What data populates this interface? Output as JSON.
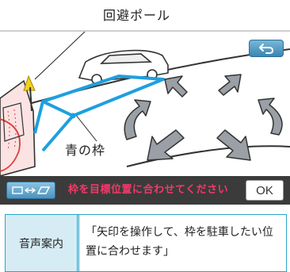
{
  "callouts": {
    "pole_label": "回避ポール",
    "frame_label": "青の枠"
  },
  "screen": {
    "back_icon": "return-arrow-icon",
    "switch_icon": "mode-switch-icon",
    "instruction": "枠を目標位置に合わせてください",
    "ok_label": "OK",
    "colors": {
      "frame": "#1e9fe0",
      "instruction": "#f03a6a",
      "button_blue": "#4c92be",
      "pole": "#f2d11c"
    }
  },
  "voice_guide": {
    "header": "音声案内",
    "text": "「矢印を操作して、枠を駐車したい位置に合わせます」"
  }
}
